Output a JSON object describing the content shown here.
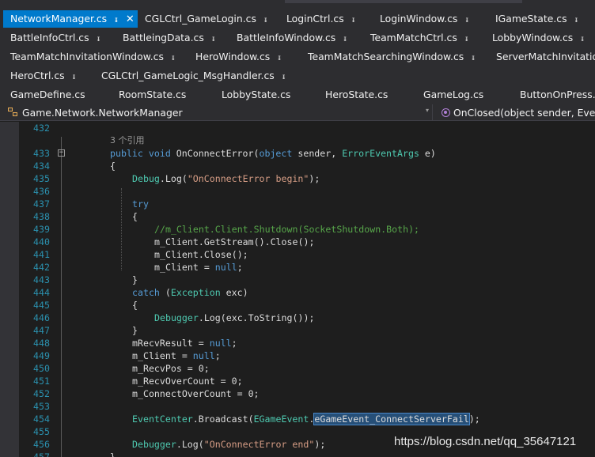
{
  "tabs": {
    "active": {
      "label": "NetworkManager.cs",
      "pin": "ᵻ",
      "close": "✕"
    },
    "rows": [
      [
        "CGLCtrl_GameLogin.cs",
        "LoginCtrl.cs",
        "LoginWindow.cs",
        "IGameState.cs"
      ],
      [
        "BattleInfoCtrl.cs",
        "BattleingData.cs",
        "BattleInfoWindow.cs",
        "TeamMatchCtrl.cs",
        "LobbyWindow.cs"
      ],
      [
        "TeamMatchInvitationWindow.cs",
        "HeroWindow.cs",
        "TeamMatchSearchingWindow.cs",
        "ServerMatchInvitation"
      ],
      [
        "HeroCtrl.cs",
        "CGLCtrl_GameLogic_MsgHandler.cs"
      ],
      [
        "GameDefine.cs",
        "RoomState.cs",
        "LobbyState.cs",
        "HeroState.cs",
        "GameLog.cs",
        "ButtonOnPress.cs"
      ]
    ]
  },
  "navbar": {
    "class_path": "Game.Network.NetworkManager",
    "member": "OnClosed(object sender, Event"
  },
  "editor": {
    "ref_count": "3 个引用",
    "lines": [
      {
        "n": "432",
        "code": ""
      },
      {
        "n": "433",
        "code": "public void OnConnectError(object sender, ErrorEventArgs e)"
      },
      {
        "n": "434",
        "code": "{"
      },
      {
        "n": "435",
        "code": "    Debug.Log(\"OnConnectError begin\");"
      },
      {
        "n": "436",
        "code": ""
      },
      {
        "n": "437",
        "code": "    try"
      },
      {
        "n": "438",
        "code": "    {"
      },
      {
        "n": "439",
        "code": "        //m_Client.Client.Shutdown(SocketShutdown.Both);"
      },
      {
        "n": "440",
        "code": "        m_Client.GetStream().Close();"
      },
      {
        "n": "441",
        "code": "        m_Client.Close();"
      },
      {
        "n": "442",
        "code": "        m_Client = null;"
      },
      {
        "n": "443",
        "code": "    }"
      },
      {
        "n": "444",
        "code": "    catch (Exception exc)"
      },
      {
        "n": "445",
        "code": "    {"
      },
      {
        "n": "446",
        "code": "        Debugger.Log(exc.ToString());"
      },
      {
        "n": "447",
        "code": "    }"
      },
      {
        "n": "448",
        "code": "    mRecvResult = null;"
      },
      {
        "n": "449",
        "code": "    m_Client = null;"
      },
      {
        "n": "450",
        "code": "    m_RecvPos = 0;"
      },
      {
        "n": "451",
        "code": "    m_RecvOverCount = 0;"
      },
      {
        "n": "452",
        "code": "    m_ConnectOverCount = 0;"
      },
      {
        "n": "453",
        "code": ""
      },
      {
        "n": "454",
        "code": "    EventCenter.Broadcast(EGameEvent.eGameEvent_ConnectServerFail);"
      },
      {
        "n": "455",
        "code": ""
      },
      {
        "n": "456",
        "code": "    Debugger.Log(\"OnConnectError end\");"
      },
      {
        "n": "457",
        "code": "}"
      }
    ]
  },
  "watermark": "https://blog.csdn.net/qq_35647121",
  "colors": {
    "accent": "#007acc",
    "keyword": "#569cd6",
    "type": "#4ec9b0",
    "string": "#d69d85",
    "comment": "#57a64a",
    "line_number": "#2b91af"
  }
}
